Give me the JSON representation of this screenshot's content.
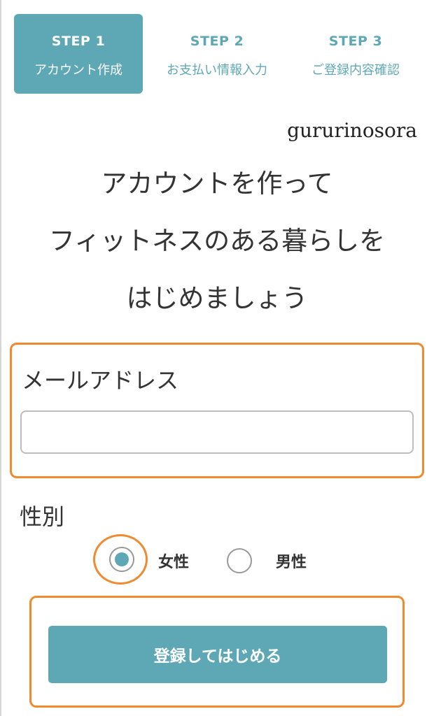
{
  "steps": [
    {
      "number": "STEP 1",
      "label": "アカウント作成",
      "active": true
    },
    {
      "number": "STEP 2",
      "label": "お支払い情報入力",
      "active": false
    },
    {
      "number": "STEP 3",
      "label": "ご登録内容確認",
      "active": false
    }
  ],
  "brand": "gururinosora",
  "headline": {
    "line1": "アカウントを作って",
    "line2": "フィットネスのある暮らしを",
    "line3": "はじめましょう"
  },
  "email": {
    "label": "メールアドレス",
    "value": "",
    "placeholder": ""
  },
  "gender": {
    "label": "性別",
    "options": [
      {
        "label": "女性",
        "selected": true
      },
      {
        "label": "男性",
        "selected": false
      }
    ]
  },
  "submit": {
    "label": "登録してはじめる"
  },
  "colors": {
    "accent": "#5ea8b6",
    "highlight": "#f08a2e"
  }
}
